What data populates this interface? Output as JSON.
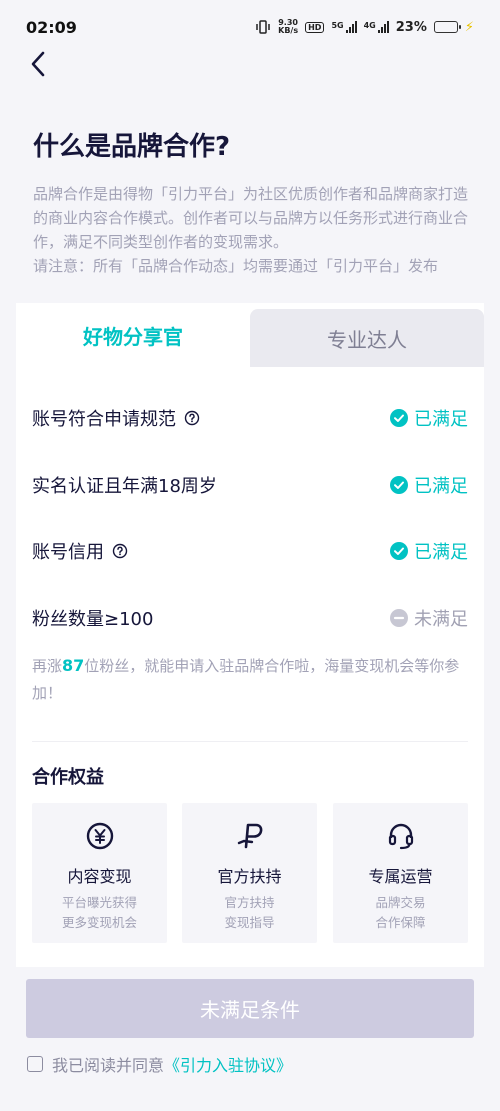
{
  "status_bar": {
    "time": "02:09",
    "net_speed_top": "9.30",
    "net_speed_bottom": "KB/s",
    "hd_badge": "HD",
    "sim1": "5G",
    "sim2": "4G",
    "battery": "23%",
    "battery_level": 0.23
  },
  "header": {
    "back_icon": "chevron-left-icon"
  },
  "page": {
    "title": "什么是品牌合作?",
    "intro_line1": "品牌合作是由得物「引力平台」为社区优质创作者和品牌商家打造的商业内容合作模式。创作者可以与品牌方以任务形式进行商业合作，满足不同类型创作者的变现需求。",
    "intro_line2": "请注意：所有「品牌合作动态」均需要通过「引力平台」发布"
  },
  "tabs": [
    {
      "label": "好物分享官",
      "active": true
    },
    {
      "label": "专业达人",
      "active": false
    }
  ],
  "requirements": [
    {
      "label": "账号符合申请规范",
      "has_help": true,
      "status": "已满足",
      "met": true
    },
    {
      "label": "实名认证且年满18周岁",
      "has_help": false,
      "status": "已满足",
      "met": true
    },
    {
      "label": "账号信用",
      "has_help": true,
      "status": "已满足",
      "met": true
    },
    {
      "label": "粉丝数量≥100",
      "has_help": false,
      "status": "未满足",
      "met": false
    }
  ],
  "hint": {
    "prefix": "再涨",
    "number": "87",
    "suffix": "位粉丝，就能申请入驻品牌合作啦，海量变现机会等你参加！"
  },
  "benefits": {
    "title": "合作权益",
    "items": [
      {
        "icon": "yen-coin-icon",
        "title": "内容变现",
        "desc1": "平台曝光获得",
        "desc2": "更多变现机会"
      },
      {
        "icon": "support-p-icon",
        "title": "官方扶持",
        "desc1": "官方扶持",
        "desc2": "变现指导"
      },
      {
        "icon": "headset-icon",
        "title": "专属运营",
        "desc1": "品牌交易",
        "desc2": "合作保障"
      }
    ]
  },
  "submit": {
    "label": "未满足条件",
    "enabled": false
  },
  "agreement": {
    "prefix": "我已阅读并同意",
    "link": "《引力入驻协议》",
    "checked": false
  },
  "colors": {
    "accent": "#01c2c3",
    "background": "#f5f5f9",
    "text": "#16163a",
    "muted": "#a2a2b6",
    "disabled_button": "#cdcbe0"
  }
}
